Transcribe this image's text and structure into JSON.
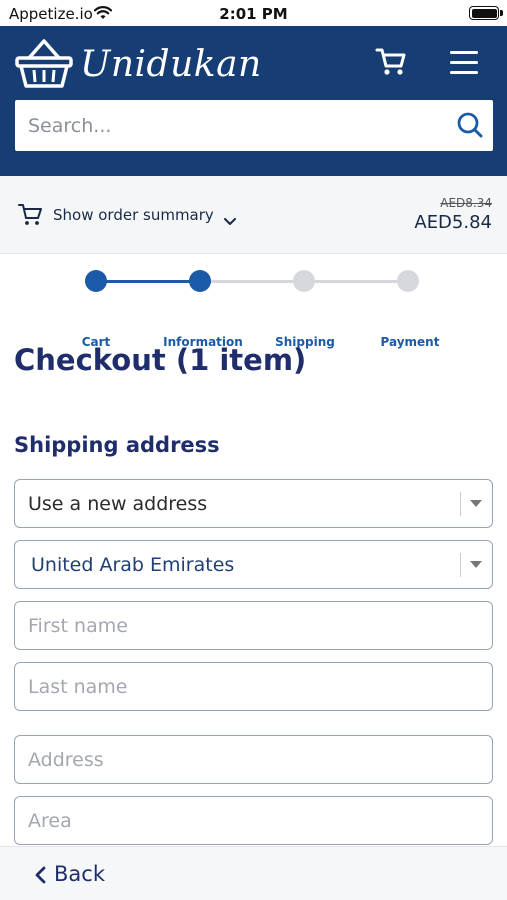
{
  "status_bar": {
    "carrier": "Appetize.io",
    "time": "2:01 PM"
  },
  "header": {
    "brand": "Unidukan",
    "search_placeholder": "Search..."
  },
  "order_summary": {
    "toggle_label": "Show order summary",
    "original_price": "AED8.34",
    "total_price": "AED5.84"
  },
  "progress": {
    "steps": [
      {
        "label": "Cart",
        "completed": true
      },
      {
        "label": "Information",
        "completed": true
      },
      {
        "label": "Shipping",
        "completed": false
      },
      {
        "label": "Payment",
        "completed": false
      }
    ]
  },
  "checkout": {
    "title": "Checkout (1 item)",
    "section_title": "Shipping address",
    "address_select": "Use a new address",
    "country_select": "United Arab Emirates",
    "first_name_placeholder": "First name",
    "last_name_placeholder": "Last name",
    "address_placeholder": "Address",
    "area_placeholder": "Area"
  },
  "footer": {
    "back_label": "Back"
  },
  "colors": {
    "header_bg": "#163e74",
    "accent": "#1b5aa6",
    "title": "#1f2d6b",
    "inactive_step": "#d6d8de"
  }
}
